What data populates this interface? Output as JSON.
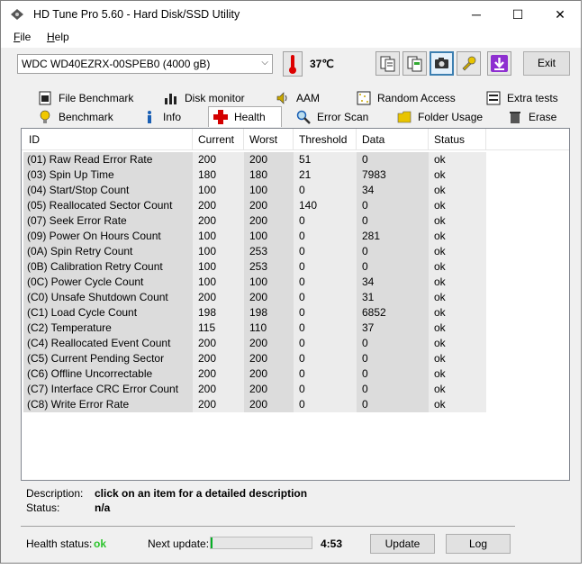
{
  "window": {
    "title": "HD Tune Pro 5.60 - Hard Disk/SSD Utility",
    "minimize": "─",
    "maximize": "☐",
    "close": "✕"
  },
  "menu": {
    "file": "File",
    "help": "Help"
  },
  "toolbar": {
    "drive_selected": "WDC WD40EZRX-00SPEB0 (4000 gB)",
    "temperature": "37℃",
    "exit_label": "Exit",
    "icons": [
      "copy-text-icon",
      "copy-info-icon",
      "screenshot-camera-icon",
      "settings-wrench-icon",
      "save-download-icon"
    ]
  },
  "tabs_row1": [
    {
      "label": "File Benchmark",
      "icon": "file-benchmark-icon"
    },
    {
      "label": "Disk monitor",
      "icon": "disk-monitor-icon"
    },
    {
      "label": "AAM",
      "icon": "speaker-icon"
    },
    {
      "label": "Random Access",
      "icon": "random-access-icon"
    },
    {
      "label": "Extra tests",
      "icon": "extra-tests-icon"
    }
  ],
  "tabs_row2": [
    {
      "label": "Benchmark",
      "icon": "benchmark-bulb-icon"
    },
    {
      "label": "Info",
      "icon": "info-icon"
    },
    {
      "label": "Health",
      "icon": "health-cross-icon"
    },
    {
      "label": "Error Scan",
      "icon": "magnifier-icon"
    },
    {
      "label": "Folder Usage",
      "icon": "folder-icon"
    },
    {
      "label": "Erase",
      "icon": "trash-icon"
    }
  ],
  "active_tab": "Health",
  "table": {
    "columns": [
      "ID",
      "Current",
      "Worst",
      "Threshold",
      "Data",
      "Status"
    ],
    "rows": [
      [
        "(01) Raw Read Error Rate",
        "200",
        "200",
        "51",
        "0",
        "ok"
      ],
      [
        "(03) Spin Up Time",
        "180",
        "180",
        "21",
        "7983",
        "ok"
      ],
      [
        "(04) Start/Stop Count",
        "100",
        "100",
        "0",
        "34",
        "ok"
      ],
      [
        "(05) Reallocated Sector Count",
        "200",
        "200",
        "140",
        "0",
        "ok"
      ],
      [
        "(07) Seek Error Rate",
        "200",
        "200",
        "0",
        "0",
        "ok"
      ],
      [
        "(09) Power On Hours Count",
        "100",
        "100",
        "0",
        "281",
        "ok"
      ],
      [
        "(0A) Spin Retry Count",
        "100",
        "253",
        "0",
        "0",
        "ok"
      ],
      [
        "(0B) Calibration Retry Count",
        "100",
        "253",
        "0",
        "0",
        "ok"
      ],
      [
        "(0C) Power Cycle Count",
        "100",
        "100",
        "0",
        "34",
        "ok"
      ],
      [
        "(C0) Unsafe Shutdown Count",
        "200",
        "200",
        "0",
        "31",
        "ok"
      ],
      [
        "(C1) Load Cycle Count",
        "198",
        "198",
        "0",
        "6852",
        "ok"
      ],
      [
        "(C2) Temperature",
        "115",
        "110",
        "0",
        "37",
        "ok"
      ],
      [
        "(C4) Reallocated Event Count",
        "200",
        "200",
        "0",
        "0",
        "ok"
      ],
      [
        "(C5) Current Pending Sector",
        "200",
        "200",
        "0",
        "0",
        "ok"
      ],
      [
        "(C6) Offline Uncorrectable",
        "200",
        "200",
        "0",
        "0",
        "ok"
      ],
      [
        "(C7) Interface CRC Error Count",
        "200",
        "200",
        "0",
        "0",
        "ok"
      ],
      [
        "(C8) Write Error Rate",
        "200",
        "200",
        "0",
        "0",
        "ok"
      ]
    ]
  },
  "description": {
    "label": "Description:",
    "value": "click on an item for a detailed description",
    "status_label": "Status:",
    "status_value": "n/a"
  },
  "footer": {
    "health_status_label": "Health status:",
    "health_status_value": "ok",
    "next_update_label": "Next update:",
    "next_update_progress": 0.02,
    "next_update_time": "4:53",
    "update_button": "Update",
    "log_button": "Log"
  },
  "colors": {
    "ok_green": "#2cc42c",
    "progress_green": "#06b025",
    "active_tool_border": "#3c7fb1"
  }
}
